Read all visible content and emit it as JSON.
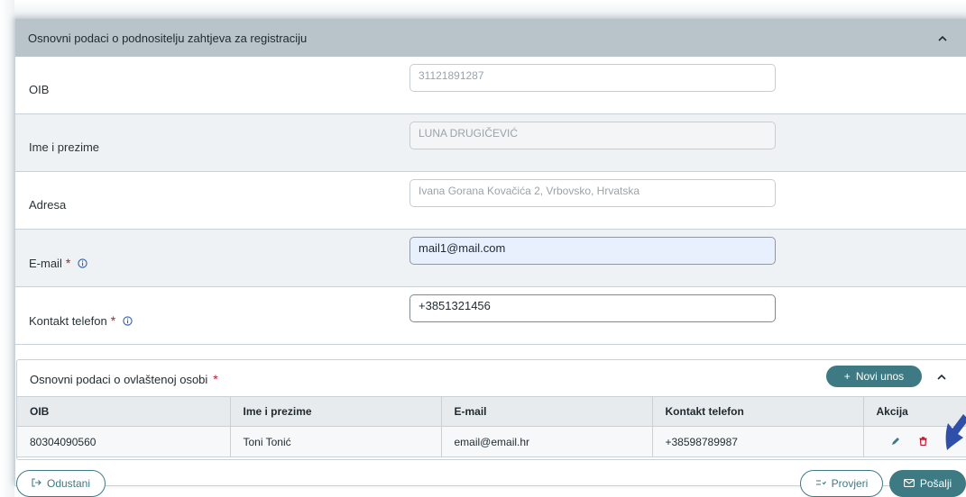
{
  "main_section": {
    "title": "Osnovni podaci o podnositelju zahtjeva za registraciju"
  },
  "fields": [
    {
      "label": "OIB",
      "value": "31121891287",
      "required": false
    },
    {
      "label": "Ime i prezime",
      "value": "LUNA DRUGIČEVIĆ",
      "required": false
    },
    {
      "label": "Adresa",
      "value": "Ivana Gorana Kovačića 2, Vrbovsko, Hrvatska",
      "required": false
    },
    {
      "label": "E-mail",
      "value": "mail1@mail.com",
      "required": true,
      "req_mark": "*"
    },
    {
      "label": "Kontakt telefon",
      "value": "+3851321456",
      "required": true,
      "req_mark": "*"
    }
  ],
  "authorized_section": {
    "title": "Osnovni podaci o ovlaštenoj osobi",
    "req_mark": "*",
    "add_button": "Novi unos",
    "add_icon": "+",
    "columns": [
      "OIB",
      "Ime i prezime",
      "E-mail",
      "Kontakt telefon",
      "Akcija"
    ],
    "rows": [
      [
        "80304090560",
        "Toni Tonić",
        "email@email.hr",
        "+38598789987"
      ]
    ]
  },
  "footer": {
    "cancel_label": "Odustani",
    "check_label": "Provjeri",
    "send_label": "Pošalji"
  },
  "colors": {
    "accent": "#3d7a84",
    "header_bg": "#b8c4ca",
    "required": "#c0152f",
    "info": "#2a5fb0"
  }
}
